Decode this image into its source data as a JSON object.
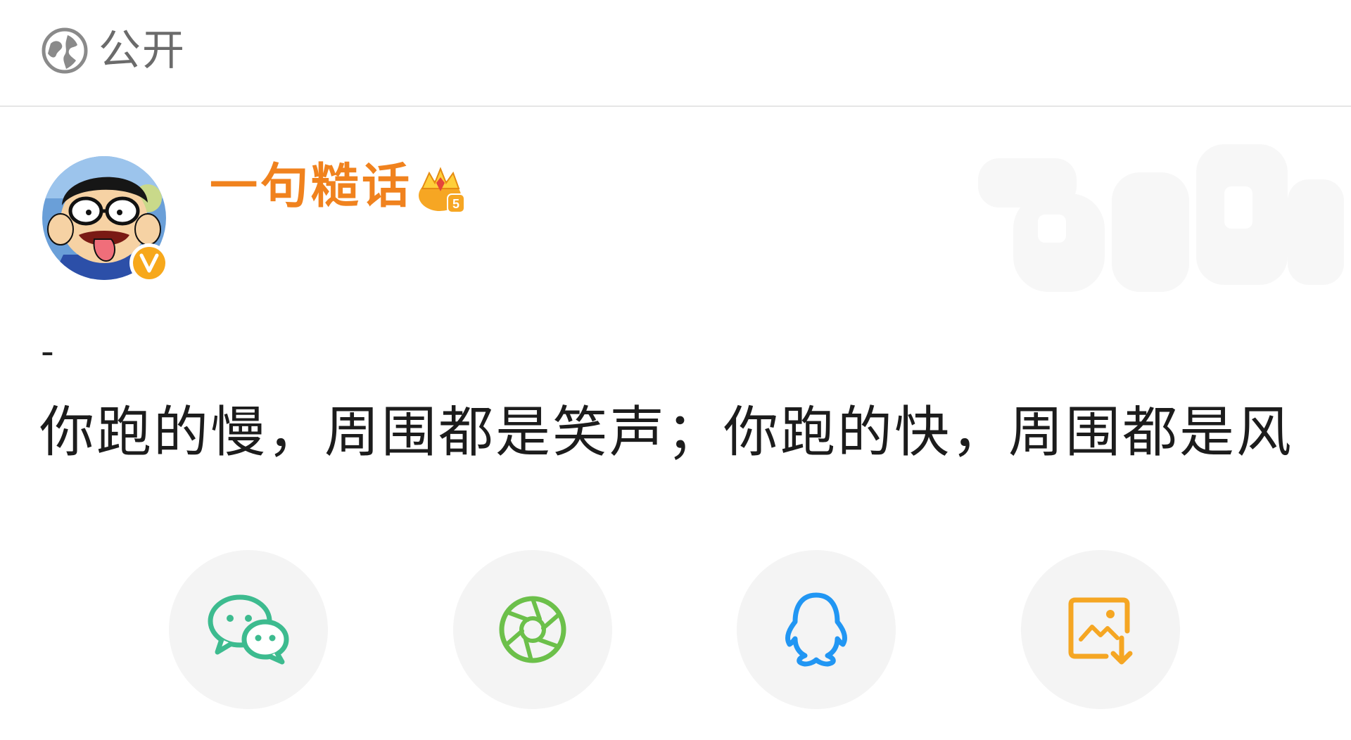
{
  "header": {
    "visibility_label": "公开",
    "visibility_icon": "globe-icon"
  },
  "profile": {
    "username": "一句糙话",
    "vip_level": "5",
    "verified_badge": "V",
    "colors": {
      "username": "#f0821e",
      "verified_badge": "#f7a81b"
    }
  },
  "post": {
    "prefix": "-",
    "text": "你跑的慢，周围都是笑声；你跑的快，周围都是风"
  },
  "share": {
    "buttons": [
      {
        "icon": "wechat-icon",
        "color": "#3dbb8f"
      },
      {
        "icon": "moments-icon",
        "color": "#6cc04a"
      },
      {
        "icon": "qq-icon",
        "color": "#2196f3"
      },
      {
        "icon": "save-image-icon",
        "color": "#f5a623"
      }
    ]
  }
}
